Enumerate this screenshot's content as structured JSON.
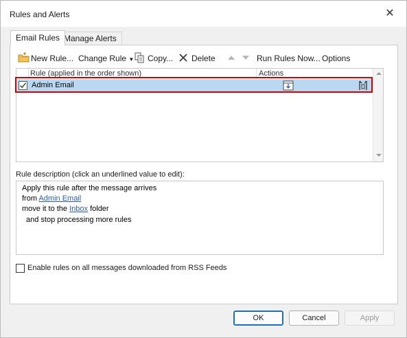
{
  "dialog": {
    "title": "Rules and Alerts",
    "close_glyph": "✕"
  },
  "tabs": [
    {
      "label": "Email Rules",
      "active": true
    },
    {
      "label": "Manage Alerts",
      "active": false
    }
  ],
  "toolbar": {
    "new_rule": "New Rule...",
    "change_rule": "Change Rule",
    "copy": "Copy...",
    "delete": "Delete",
    "run_rules": "Run Rules Now...",
    "options": "Options"
  },
  "rules_list": {
    "columns": [
      "Rule (applied in the order shown)",
      "Actions"
    ],
    "rows": [
      {
        "name": "Admin Email",
        "enabled": true,
        "selected": true
      }
    ]
  },
  "description": {
    "label": "Rule description (click an underlined value to edit):",
    "line1": "Apply this rule after the message arrives",
    "line2_prefix": "from ",
    "line2_link": "Admin Email",
    "line3_prefix": "move it to the ",
    "line3_link": "Inbox",
    "line3_suffix": " folder",
    "line4": "and stop processing more rules"
  },
  "rss": {
    "label": "Enable rules on all messages downloaded from RSS Feeds",
    "checked": false
  },
  "buttons": {
    "ok": "OK",
    "cancel": "Cancel",
    "apply": "Apply"
  },
  "colors": {
    "selection_row": "#b9d8f1",
    "selection_outline": "#d40000",
    "link": "#2a5db0",
    "ok_border": "#1f6fb4"
  }
}
